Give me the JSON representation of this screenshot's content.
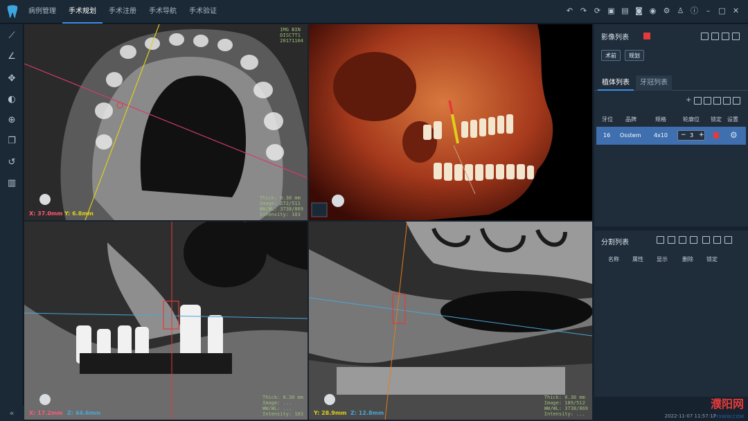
{
  "nav": {
    "tabs": [
      "病例管理",
      "手术规划",
      "手术注册",
      "手术导航",
      "手术验证"
    ],
    "active_index": 1
  },
  "toolbar": {
    "icons": [
      "undo-icon",
      "redo-icon",
      "export-icon",
      "save-icon",
      "screenshot-icon",
      "capture-icon",
      "settings-icon",
      "user-icon",
      "info-icon",
      "minimize-icon",
      "maximize-icon",
      "close-icon"
    ]
  },
  "left_tools": [
    "measure-icon",
    "angle-icon",
    "pan-icon",
    "contrast-icon",
    "zoom-icon",
    "layers-icon",
    "rotate-icon",
    "teeth-icon"
  ],
  "viewports": {
    "axial": {
      "top_right": [
        "IMG BIN",
        "DISCTT1",
        "20171104"
      ],
      "bottom_right": [
        "Thick: 0.30 mm",
        "Image: 272/511",
        "WW/WL: 3738/869",
        "Intensity: 103"
      ],
      "coord_x": "X: 37.0mm",
      "coord_y": "Y: 6.8mm"
    },
    "coronal": {
      "bottom_right": [
        "Thick: 0.30 mm",
        "Image: ...",
        "WW/WL: ...",
        "Intensity: 103"
      ],
      "coord_x": "X: 17.2mm",
      "coord_z": "Z: 44.6mm"
    },
    "sagittal": {
      "bottom_right": [
        "Thick: 0.30 mm",
        "Image: 189/512",
        "WW/WL: 3738/869",
        "Intensity: ..."
      ],
      "coord_y": "Y: 28.9mm",
      "coord_z": "Z: 12.8mm"
    }
  },
  "right_panel": {
    "image_list_title": "影像列表",
    "image_buttons": [
      "术前",
      "规划"
    ],
    "tabs": [
      "植体列表",
      "牙冠列表"
    ],
    "implant_table": {
      "headers": [
        "牙位",
        "品牌",
        "规格",
        "轮廓位",
        "锁定",
        "设置"
      ],
      "rows": [
        {
          "tooth": "16",
          "brand": "Osstem",
          "spec": "4x10",
          "value": "3"
        }
      ]
    },
    "segment_title": "分割列表",
    "segment_headers": [
      "名称",
      "属性",
      "显示",
      "删除",
      "锁定"
    ]
  },
  "statusbar": {
    "datetime": "2022-11-07 11:57:17"
  },
  "watermark": {
    "text": "濮阳网",
    "url": "PYXWW.COM"
  },
  "colors": {
    "accent": "#3e8de6",
    "yellow_line": "#e0cf1a",
    "pink_line": "#d63a6e",
    "blue_line": "#4aa7d8",
    "orange_line": "#e87b1e",
    "red_implant": "#e23b3b",
    "selected_row": "#3f6fae"
  }
}
